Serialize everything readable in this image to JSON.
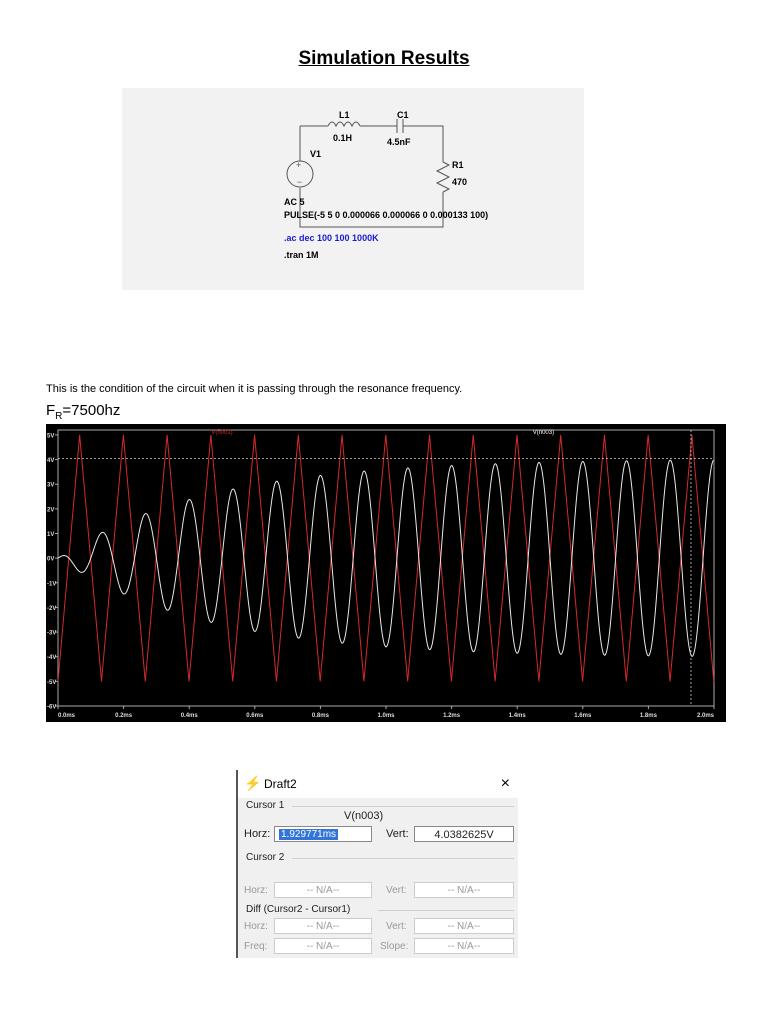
{
  "heading": "Simulation Results",
  "schematic": {
    "l1_name": "L1",
    "l1_value": "0.1H",
    "c1_name": "C1",
    "c1_value": "4.5nF",
    "r1_name": "R1",
    "r1_value": "470",
    "v1_name": "V1",
    "source_ac": "AC 5",
    "source_pulse": "PULSE(-5 5 0 0.000066 0.000066 0 0.000133 100)",
    "directive_ac": ".ac dec 100 100 1000K",
    "directive_tran": ".tran 1M"
  },
  "description": "This is the condition of the circuit when it is passing through the resonance frequency.",
  "resonance": {
    "prefix": "F",
    "sub": "R",
    "value": "=7500hz"
  },
  "chart_data": {
    "type": "line",
    "legend": [
      "V(n001)",
      "V(n003)"
    ],
    "x_ticks": [
      "0.0ms",
      "0.2ms",
      "0.4ms",
      "0.6ms",
      "0.8ms",
      "1.0ms",
      "1.2ms",
      "1.4ms",
      "1.6ms",
      "1.8ms",
      "2.0ms"
    ],
    "y_ticks": [
      "5V",
      "4V",
      "3V",
      "2V",
      "1V",
      "0V",
      "-1V",
      "-2V",
      "-3V",
      "-4V",
      "-5V",
      "-6V"
    ],
    "xlim": [
      0,
      2.0
    ],
    "ylim": [
      -6,
      5.2
    ],
    "x_unit": "ms",
    "series": [
      {
        "name": "V(n001)",
        "color": "#d42a2a",
        "shape": "triangle",
        "amplitude": 5,
        "frequency_hz": 7500
      },
      {
        "name": "V(n003)",
        "color": "#e8e8e8",
        "shape": "sine",
        "final_amplitude": 4.04,
        "frequency_hz": 7500
      }
    ],
    "cursor": {
      "time_ms": 1.929771,
      "level_v": 4.0382625
    }
  },
  "cursor_window": {
    "title": "Draft2",
    "close": "×",
    "cursor1_label": "Cursor 1",
    "trace": "V(n003)",
    "horz_label": "Horz:",
    "horz_value": "1.929771ms",
    "vert_label": "Vert:",
    "vert_value": "4.0382625V",
    "cursor2_label": "Cursor 2",
    "c2_horz_label": "Horz:",
    "c2_horz_value": "-- N/A--",
    "c2_vert_label": "Vert:",
    "c2_vert_value": "-- N/A--",
    "diff_label": "Diff (Cursor2 - Cursor1)",
    "diff_horz_label": "Horz:",
    "diff_horz_value": "-- N/A--",
    "diff_vert_label": "Vert:",
    "diff_vert_value": "-- N/A--",
    "freq_label": "Freq:",
    "freq_value": "-- N/A--",
    "slope_label": "Slope:",
    "slope_value": "-- N/A--"
  }
}
